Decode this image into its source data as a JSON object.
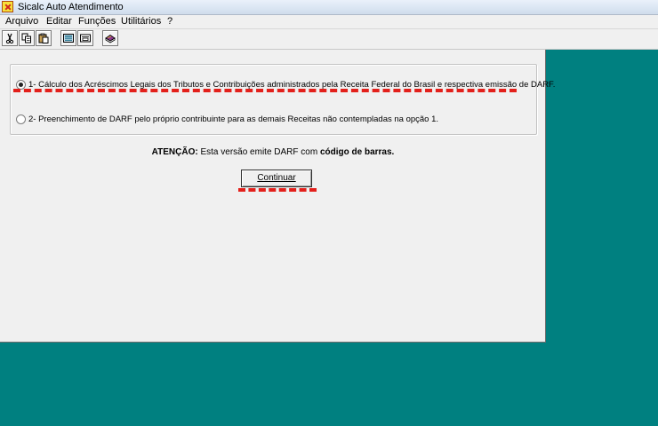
{
  "window": {
    "title": "Sicalc Auto Atendimento"
  },
  "menu": {
    "items": [
      "Arquivo",
      "Editar",
      "Funções",
      "Utilitários",
      "?"
    ]
  },
  "toolbar": {
    "buttons": [
      "cut-icon",
      "copy-icon",
      "paste-icon",
      "calculator-icon",
      "form-icon",
      "help-book-icon"
    ]
  },
  "options": [
    {
      "label": "1- Cálculo dos Acréscimos Legais dos Tributos e Contribuições administrados pela Receita Federal do Brasil  e respectiva emissão de DARF.",
      "selected": true
    },
    {
      "label": "2- Preenchimento de DARF pelo próprio contribuinte para as demais Receitas não contempladas na opção 1.",
      "selected": false
    }
  ],
  "notice": {
    "label": "ATENÇÃO:",
    "text": "Esta versão emite DARF com",
    "emphasis": "código de barras."
  },
  "continue_button": {
    "label": "Continuar"
  },
  "colors": {
    "desktop": "#008080",
    "annotation": "#e3201b"
  }
}
